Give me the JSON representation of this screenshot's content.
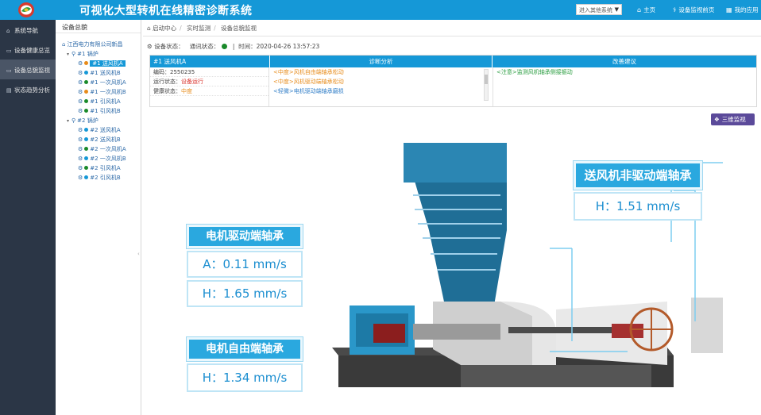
{
  "header": {
    "title": "可视化大型转机在线精密诊断系统",
    "system_select": "进入其他系统",
    "links": [
      "主页",
      "设备监视前页",
      "我的应用"
    ]
  },
  "leftnav": {
    "items": [
      {
        "label": "系统导航",
        "icon": "home-icon"
      },
      {
        "label": "设备健康总览",
        "icon": "monitor-icon"
      },
      {
        "label": "设备总貌监视",
        "icon": "monitor-icon",
        "active": true
      },
      {
        "label": "状态趋势分析",
        "icon": "trend-icon"
      }
    ]
  },
  "tree": {
    "title": "设备总貌",
    "company": "江西电力有限公司新昌",
    "boiler1": "#1 锅炉",
    "boiler2": "#2 锅炉",
    "boiler1_items": [
      "#1 送风机A",
      "#1 送风机B",
      "#1 一次风机A",
      "#1 一次风机B",
      "#1 引风机A",
      "#1 引风机B"
    ],
    "boiler2_items": [
      "#2 送风机A",
      "#2 送风机B",
      "#2 一次风机A",
      "#2 一次风机B",
      "#2 引风机A",
      "#2 引风机B"
    ],
    "dot_colors": {
      "boiler1": [
        "#e78b1a",
        "#1598d7",
        "#1a8a2a",
        "#e78b1a",
        "#1a8a2a",
        "#1a8a2a"
      ],
      "boiler2": [
        "#1598d7",
        "#1598d7",
        "#1a8a2a",
        "#1598d7",
        "#1a8a2a",
        "#1598d7"
      ]
    }
  },
  "main": {
    "breadcrumb": [
      "启动中心",
      "实时监测",
      "设备总貌监视"
    ],
    "status": {
      "device_status": "设备状态：",
      "comm_status": "通讯状态：",
      "time_label": "时间：",
      "time": "2020-04-26 13:57:23"
    },
    "panel": {
      "equipment": "#1 送风机A",
      "diag_header": "诊断分析",
      "sugg_header": "改善建议",
      "code_label": "编码：",
      "code": "2550235",
      "run_label": "运行状态：",
      "run_value": "设备运行",
      "health_label": "健康状态：",
      "health_value": "中度",
      "diagnoses": [
        "<中度>风机自由端轴承松动",
        "<中度>风机驱动端轴承松动",
        "<轻微>电机驱动端轴承磨损"
      ],
      "suggestion": "<注意>监测风机轴承侧接振动"
    },
    "button_3d": "三维监视",
    "callouts": {
      "motor_drive": {
        "title": "电机驱动端轴承",
        "values": [
          "A：0.11 mm/s",
          "H：1.65 mm/s"
        ]
      },
      "motor_free": {
        "title": "电机自由端轴承",
        "values": [
          "H：1.34 mm/s"
        ]
      },
      "fan_nondrive": {
        "title": "送风机非驱动端轴承",
        "values": [
          "H：1.51 mm/s"
        ]
      }
    }
  },
  "colors": {
    "brand": "#1598d7",
    "nav_bg": "#2b3646",
    "ok": "#1a8a2a",
    "warn": "#e78b1a",
    "alarm": "#d9302a"
  }
}
